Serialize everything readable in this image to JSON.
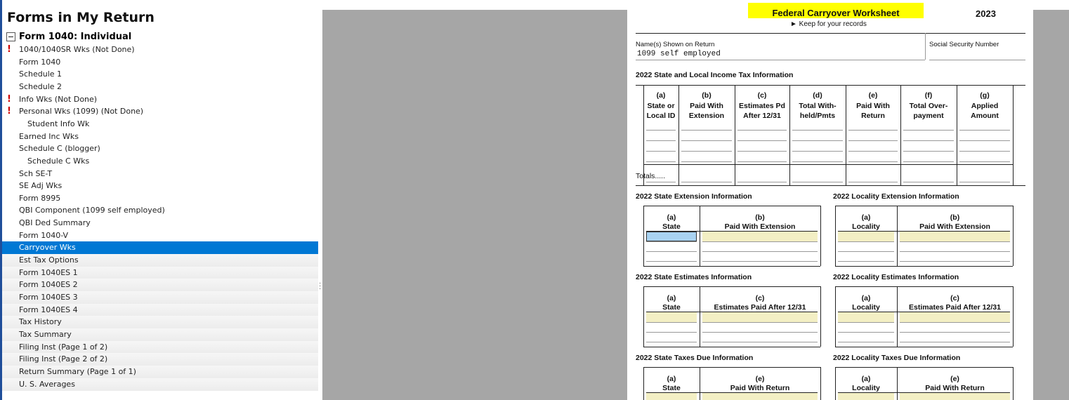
{
  "left_panel": {
    "title": "Forms in My Return",
    "root_label": "Form 1040:  Individual",
    "items": [
      {
        "label": "1040/1040SR Wks (Not Done)",
        "flag": "!"
      },
      {
        "label": "Form 1040"
      },
      {
        "label": "Schedule 1"
      },
      {
        "label": "Schedule 2"
      },
      {
        "label": "Info Wks (Not Done)",
        "flag": "!"
      },
      {
        "label": "Personal Wks (1099) (Not Done)",
        "flag": "!"
      },
      {
        "label": "Student Info Wk"
      },
      {
        "label": "Earned Inc Wks"
      },
      {
        "label": "Schedule C (blogger)"
      },
      {
        "label": "Schedule C Wks"
      },
      {
        "label": "Sch SE-T"
      },
      {
        "label": "SE Adj Wks"
      },
      {
        "label": "Form 8995"
      },
      {
        "label": "QBI Component (1099 self employed)"
      },
      {
        "label": "QBI Ded Summary"
      },
      {
        "label": "Form 1040-V"
      },
      {
        "label": "Carryover Wks"
      },
      {
        "label": "Est Tax Options"
      },
      {
        "label": "Form 1040ES 1"
      },
      {
        "label": "Form 1040ES 2"
      },
      {
        "label": "Form 1040ES 3"
      },
      {
        "label": "Form 1040ES 4"
      },
      {
        "label": "Tax History"
      },
      {
        "label": "Tax Summary"
      },
      {
        "label": "Filing Inst (Page 1 of 2)"
      },
      {
        "label": "Filing Inst (Page 2 of 2)"
      },
      {
        "label": "Return Summary (Page 1 of 1)"
      },
      {
        "label": "U. S. Averages"
      }
    ]
  },
  "worksheet": {
    "title": "Federal Carryover Worksheet",
    "subtitle": "► Keep for your records",
    "year": "2023",
    "names_label": "Name(s) Shown on Return",
    "names_value": "1099 self employed",
    "ssn_label": "Social Security Number",
    "section1_title": "2022 State and Local Income Tax Information",
    "section1_cols": [
      [
        "(a)",
        "State or",
        "Local ID"
      ],
      [
        "(b)",
        "Paid With",
        "Extension"
      ],
      [
        "(c)",
        "Estimates Pd",
        "After 12/31"
      ],
      [
        "(d)",
        "Total With-",
        "held/Pmts"
      ],
      [
        "(e)",
        "Paid With",
        "Return"
      ],
      [
        "(f)",
        "Total Over-",
        "payment"
      ],
      [
        "(g)",
        "Applied",
        "Amount"
      ]
    ],
    "totals_label": "Totals.....",
    "state_ext_title": "2022 State Extension Information",
    "locality_ext_title": "2022 Locality Extension Information",
    "state_est_title": "2022 State Estimates Information",
    "locality_est_title": "2022 Locality Estimates Information",
    "state_due_title": "2022 State Taxes Due Information",
    "locality_due_title": "2022 Locality Taxes Due Information",
    "col_a": "(a)",
    "col_b": "(b)",
    "col_c": "(c)",
    "col_e": "(e)",
    "state": "State",
    "locality": "Locality",
    "paid_ext": "Paid With Extension",
    "est_paid": "Estimates Paid After 12/31",
    "paid_ret": "Paid With Return"
  }
}
